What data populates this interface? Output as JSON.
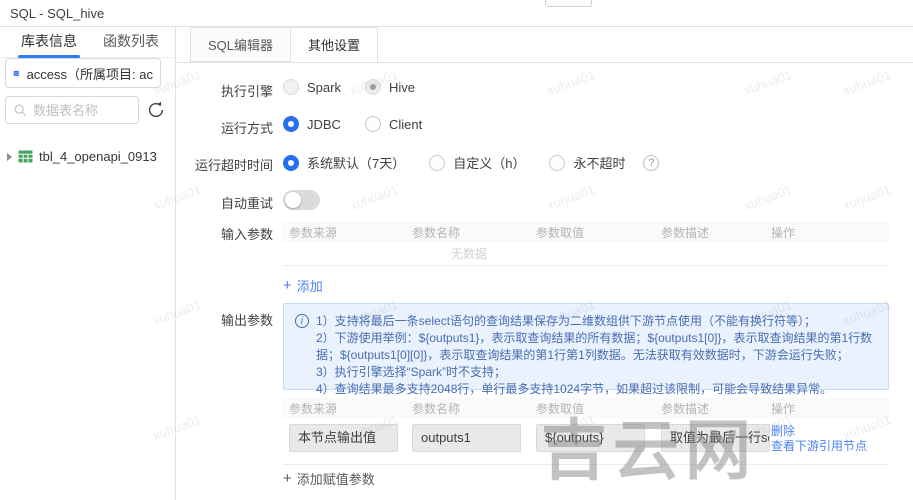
{
  "header": {
    "title": "SQL - SQL_hive"
  },
  "watermark": {
    "text": "xuhua01",
    "site_text": "吉云网"
  },
  "sidebar": {
    "tabs": [
      {
        "label": "库表信息"
      },
      {
        "label": "函数列表"
      }
    ],
    "db_selector": {
      "label": "access（所属项目: ac"
    },
    "search": {
      "placeholder": "数据表名称"
    },
    "tree": [
      {
        "label": "tbl_4_openapi_0913"
      }
    ]
  },
  "main": {
    "tabs": [
      {
        "label": "SQL编辑器"
      },
      {
        "label": "其他设置"
      }
    ],
    "form": {
      "engine": {
        "label": "执行引擎",
        "options": [
          {
            "label": "Spark",
            "checked": false,
            "disabled": true
          },
          {
            "label": "Hive",
            "checked": true,
            "disabled": true
          }
        ]
      },
      "run_mode": {
        "label": "运行方式",
        "options": [
          {
            "label": "JDBC",
            "checked": true
          },
          {
            "label": "Client",
            "checked": false
          }
        ]
      },
      "timeout": {
        "label": "运行超时时间",
        "options": [
          {
            "label": "系统默认（7天）",
            "checked": true
          },
          {
            "label": "自定义（h）",
            "checked": false
          },
          {
            "label": "永不超时",
            "checked": false
          }
        ],
        "help_glyph": "?"
      },
      "auto_retry": {
        "label": "自动重试",
        "enabled": false
      },
      "input_params": {
        "label": "输入参数",
        "columns": [
          "参数来源",
          "参数名称",
          "参数取值",
          "参数描述",
          "操作"
        ],
        "empty_text": "无数据",
        "add_label": "添加"
      },
      "output_params": {
        "label": "输出参数",
        "notice": [
          "1）支持将最后一条select语句的查询结果保存为二维数组供下游节点使用（不能有换行符等）；",
          "2）下游使用举例：${outputs1}，表示取查询结果的所有数据；${outputs1[0]}，表示取查询结果的第1行数据；${outputs1[0][0]}，表示取查询结果的第1行第1列数据。无法获取有效数据时，下游会运行失败；",
          "3）执行引擎选择“Spark”时不支持；",
          "4）查询结果最多支持2048行，单行最多支持1024字节，如果超过该限制，可能会导致结果异常。"
        ],
        "columns": [
          "参数来源",
          "参数名称",
          "参数取值",
          "参数描述",
          "操作"
        ],
        "row": {
          "source": "本节点输出值",
          "name": "outputs1",
          "value": "${outputs}",
          "desc": "取值为最后一行sele",
          "actions": [
            "删除",
            "查看下游引用节点"
          ]
        },
        "add_label": "添加赋值参数"
      }
    }
  },
  "colors": {
    "accent": "#2670f0",
    "link": "#4d82f2",
    "notice_bg": "#e9f2fd",
    "notice_text": "#4a6db3",
    "table_icon_green": "#45a45f",
    "db_icon_blue": "#3b7cf7"
  }
}
